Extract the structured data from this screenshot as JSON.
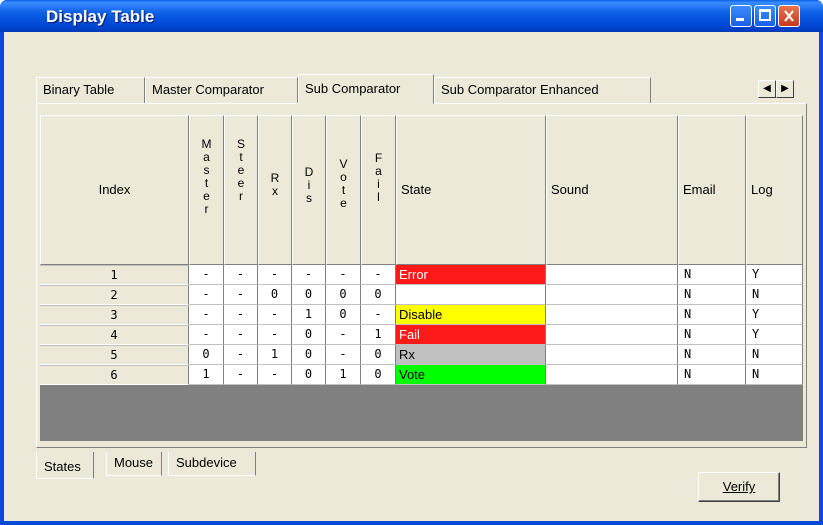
{
  "window": {
    "title": "Display Table"
  },
  "tabs": {
    "top": [
      "Binary Table",
      "Master Comparator",
      "Sub Comparator",
      "Sub Comparator Enhanced"
    ],
    "active_top": "Sub Comparator",
    "bottom": [
      "States",
      "Mouse",
      "Subdevice"
    ],
    "active_bottom": "States"
  },
  "table": {
    "headers": {
      "index": "Index",
      "master": [
        "M",
        "a",
        "s",
        "t",
        "e",
        "r"
      ],
      "steer": [
        "S",
        "t",
        "e",
        "e",
        "r"
      ],
      "rx": [
        "R",
        "x"
      ],
      "dis": [
        "D",
        "i",
        "s"
      ],
      "vote": [
        "V",
        "o",
        "t",
        "e"
      ],
      "fail": [
        "F",
        "a",
        "i",
        "l"
      ],
      "state": "State",
      "sound": "Sound",
      "email": "Email",
      "log": "Log"
    },
    "rows": [
      {
        "index": "1",
        "master": "-",
        "steer": "-",
        "rx": "-",
        "dis": "-",
        "vote": "-",
        "fail": "-",
        "state": "Error",
        "state_color": "#ff1a1a",
        "sound": "",
        "email": "N",
        "log": "Y"
      },
      {
        "index": "2",
        "master": "-",
        "steer": "-",
        "rx": "0",
        "dis": "0",
        "vote": "0",
        "fail": "0",
        "state": "",
        "state_color": "#ffffff",
        "sound": "",
        "email": "N",
        "log": "N"
      },
      {
        "index": "3",
        "master": "-",
        "steer": "-",
        "rx": "-",
        "dis": "1",
        "vote": "0",
        "fail": "-",
        "state": "Disable",
        "state_color": "#ffff00",
        "sound": "",
        "email": "N",
        "log": "Y"
      },
      {
        "index": "4",
        "master": "-",
        "steer": "-",
        "rx": "-",
        "dis": "0",
        "vote": "-",
        "fail": "1",
        "state": "Fail",
        "state_color": "#ff1a1a",
        "sound": "",
        "email": "N",
        "log": "Y"
      },
      {
        "index": "5",
        "master": "0",
        "steer": "-",
        "rx": "1",
        "dis": "0",
        "vote": "-",
        "fail": "0",
        "state": "Rx",
        "state_color": "#c0c0c0",
        "sound": "",
        "email": "N",
        "log": "N"
      },
      {
        "index": "6",
        "master": "1",
        "steer": "-",
        "rx": "-",
        "dis": "0",
        "vote": "1",
        "fail": "0",
        "state": "Vote",
        "state_color": "#00ff00",
        "sound": "",
        "email": "N",
        "log": "N"
      }
    ]
  },
  "buttons": {
    "verify": "Verify"
  },
  "colors": {
    "titlebar": "#0a4ad8",
    "panel": "#ece9d8",
    "empty_grid": "#808080"
  }
}
